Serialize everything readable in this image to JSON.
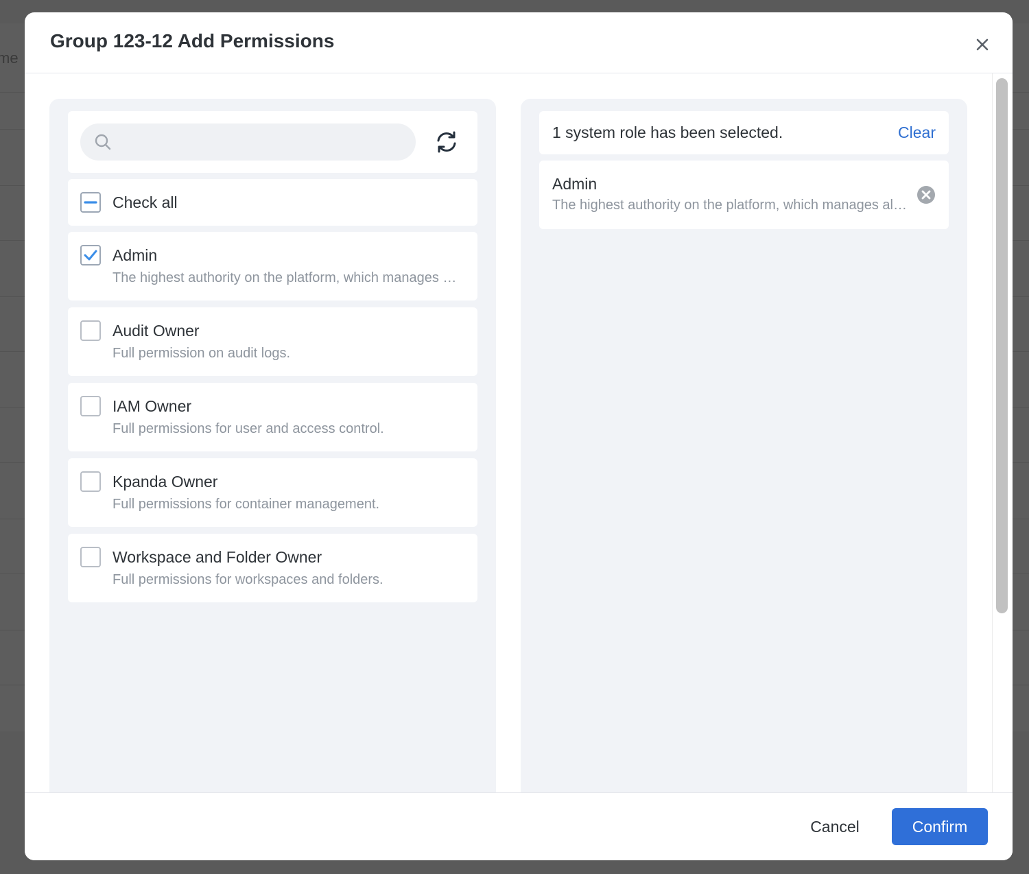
{
  "background_page": {
    "partial_text": "me"
  },
  "modal": {
    "title": "Group 123-12 Add Permissions"
  },
  "left_panel": {
    "search": {
      "value": "",
      "placeholder": ""
    },
    "check_all_label": "Check all",
    "check_all_state": "partial",
    "roles": [
      {
        "name": "Admin",
        "description": "The highest authority on the platform, which manages all resources.",
        "checked": true
      },
      {
        "name": "Audit Owner",
        "description": "Full permission on audit logs.",
        "checked": false
      },
      {
        "name": "IAM Owner",
        "description": "Full permissions for user and access control.",
        "checked": false
      },
      {
        "name": "Kpanda Owner",
        "description": "Full permissions for container management.",
        "checked": false
      },
      {
        "name": "Workspace and Folder Owner",
        "description": "Full permissions for workspaces and folders.",
        "checked": false
      }
    ]
  },
  "right_panel": {
    "selected_count_text": "1 system role has been selected.",
    "clear_label": "Clear",
    "selected": [
      {
        "name": "Admin",
        "description": "The highest authority on the platform, which manages all resources."
      }
    ]
  },
  "footer": {
    "cancel_label": "Cancel",
    "confirm_label": "Confirm"
  },
  "colors": {
    "accent": "#2f6fd8",
    "link": "#2f6fd1",
    "checkmark": "#3b8ee8",
    "panel_bg": "#f1f3f7"
  },
  "icons": {
    "close": "close-icon",
    "search": "search-icon",
    "refresh": "refresh-icon",
    "remove": "remove-circle-icon",
    "check": "checkmark-icon",
    "partial": "minus-icon"
  }
}
